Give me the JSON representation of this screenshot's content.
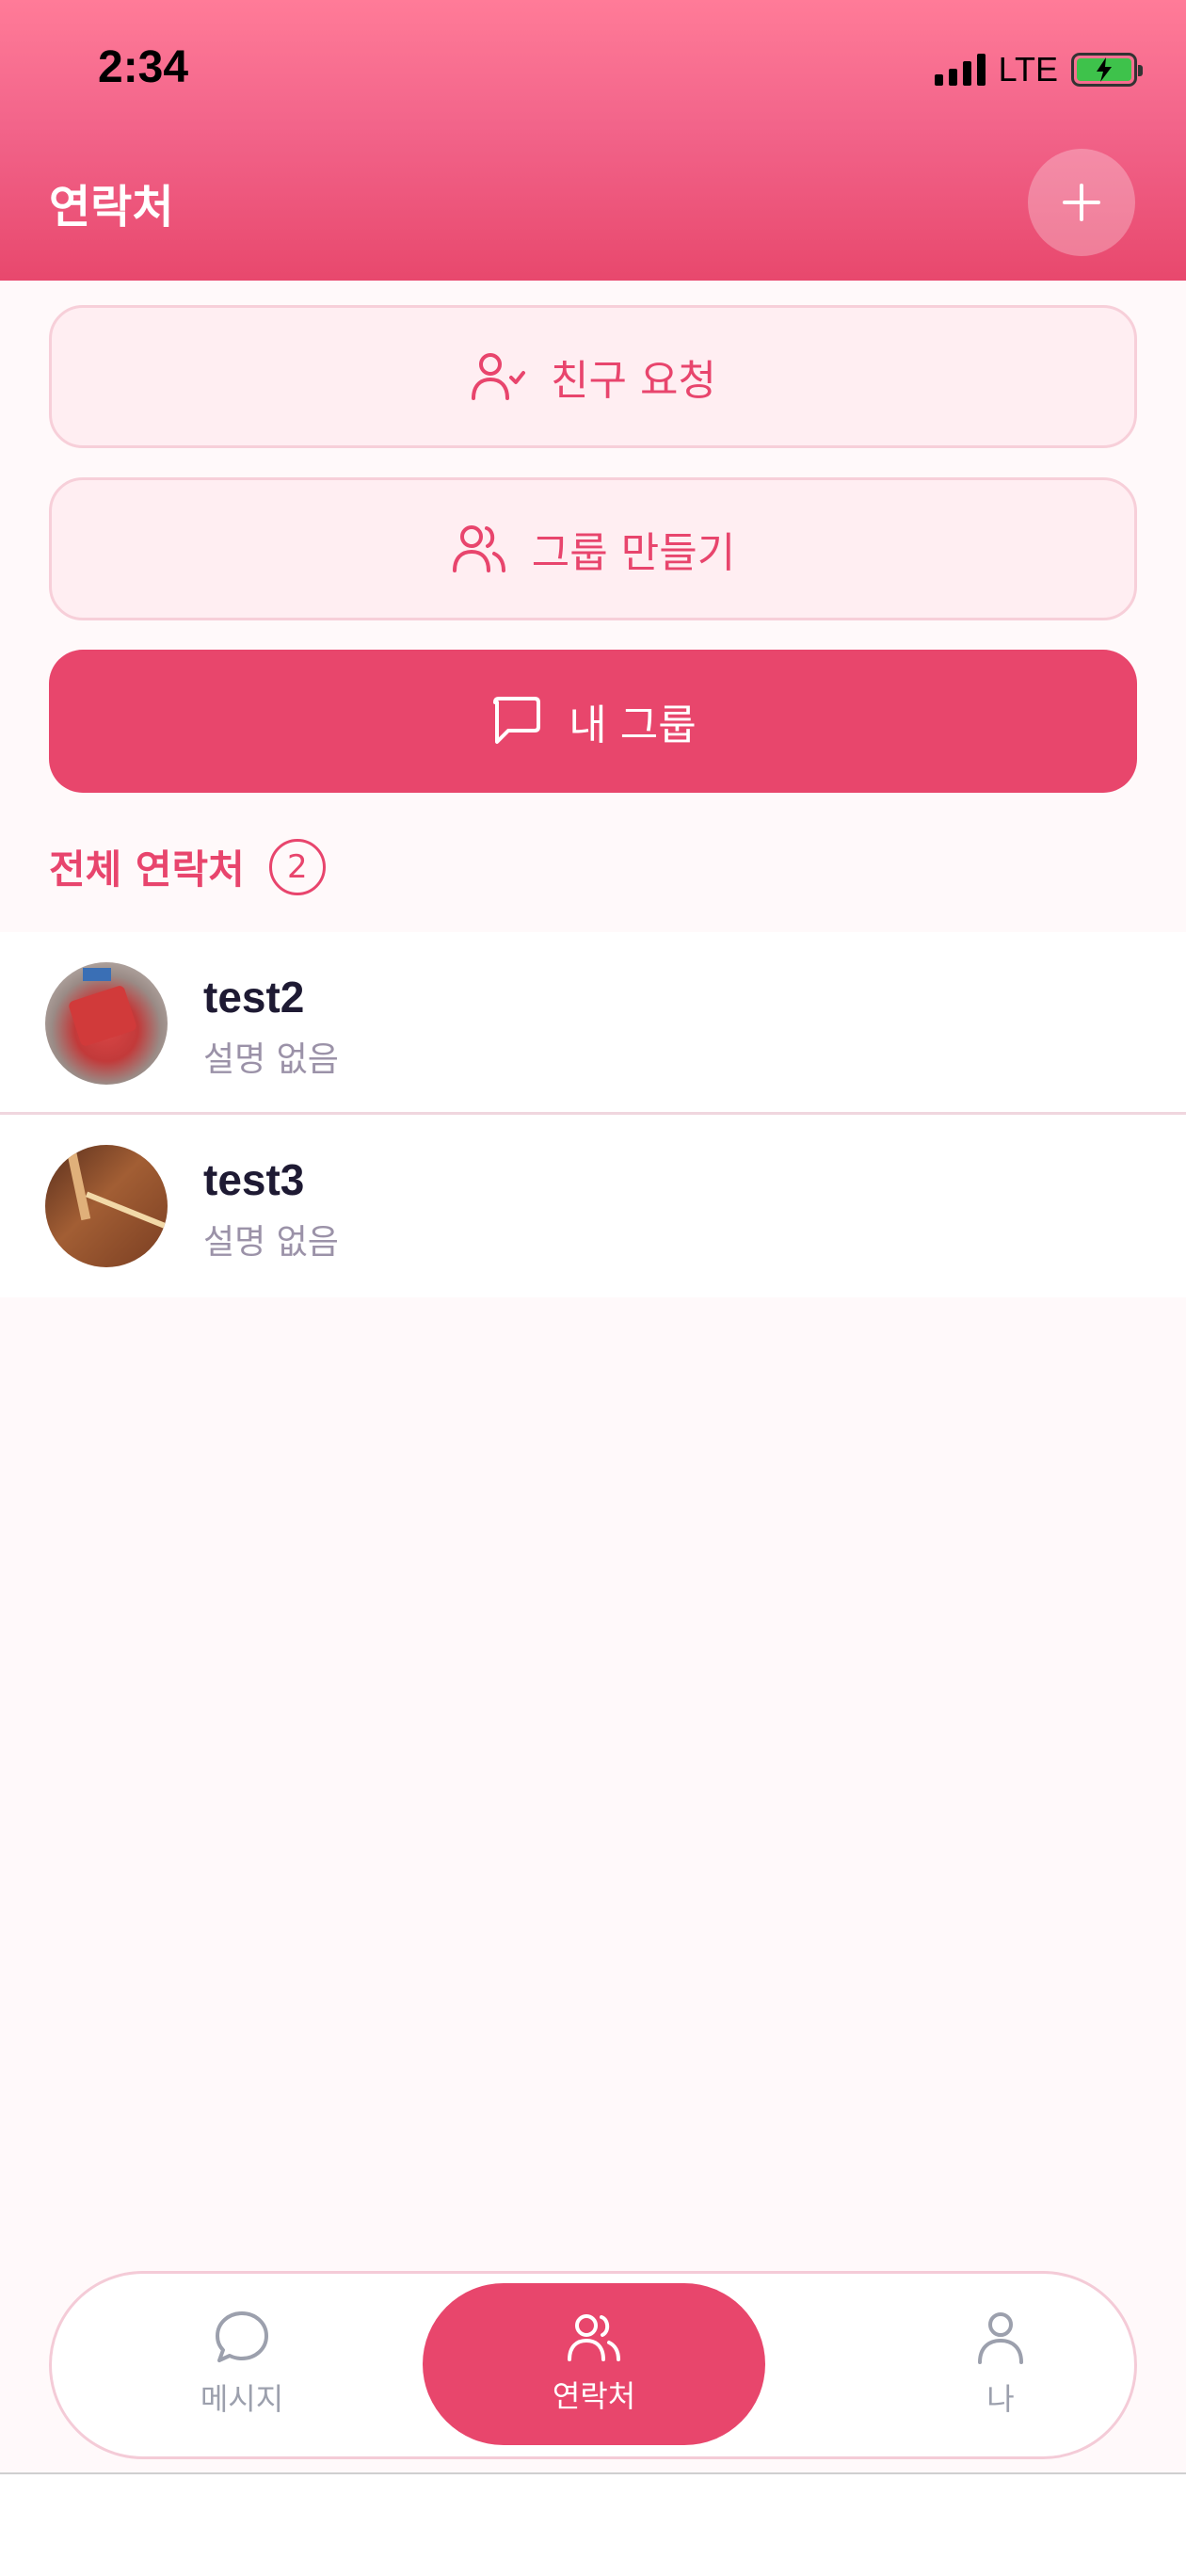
{
  "status_bar": {
    "time": "2:34",
    "network": "LTE"
  },
  "header": {
    "title": "연락처"
  },
  "actions": {
    "friend_request": "친구 요청",
    "create_group": "그룹 만들기",
    "my_groups": "내 그룹"
  },
  "contacts": {
    "section_title": "전체 연락처",
    "count": "2",
    "items": [
      {
        "name": "test2",
        "description": "설명 없음"
      },
      {
        "name": "test3",
        "description": "설명 없음"
      }
    ]
  },
  "tabbar": {
    "messages": "메시지",
    "contacts": "연락처",
    "me": "나"
  },
  "colors": {
    "accent": "#e8466c",
    "header_top": "#ff7b98",
    "background": "#fff9fa"
  }
}
